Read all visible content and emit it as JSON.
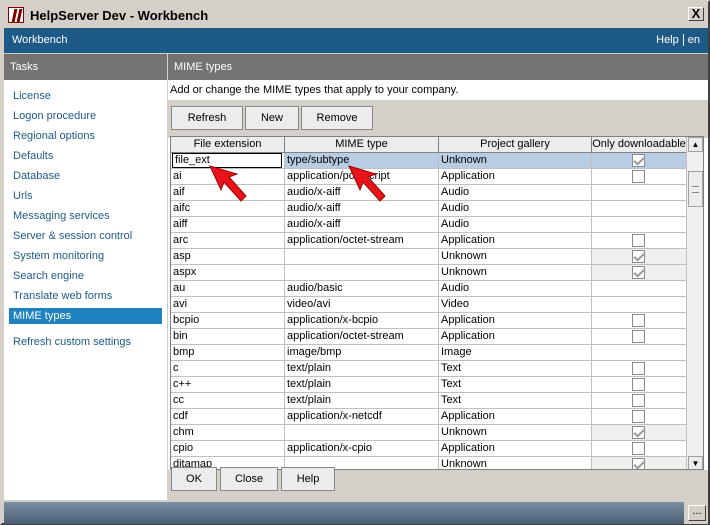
{
  "window": {
    "title": "HelpServer Dev - Workbench",
    "close_symbol": "X"
  },
  "header": {
    "app_name": "Workbench",
    "help_link": "Help",
    "lang_link": "en"
  },
  "sidebar": {
    "title": "Tasks",
    "items": [
      {
        "label": "License"
      },
      {
        "label": "Logon procedure"
      },
      {
        "label": "Regional options"
      },
      {
        "label": "Defaults"
      },
      {
        "label": "Database"
      },
      {
        "label": "Urls"
      },
      {
        "label": "Messaging services"
      },
      {
        "label": "Server & session control"
      },
      {
        "label": "System monitoring"
      },
      {
        "label": "Search engine"
      },
      {
        "label": "Translate web forms"
      },
      {
        "label": "MIME types",
        "active": true
      }
    ],
    "extra_item": "Refresh custom settings"
  },
  "main": {
    "title": "MIME types",
    "description": "Add or change the MIME types that apply to your company.",
    "buttons": {
      "refresh": "Refresh",
      "new": "New",
      "remove": "Remove"
    },
    "columns": [
      "File extension",
      "MIME type",
      "Project gallery",
      "Only downloadable"
    ],
    "rows": [
      {
        "ext": "file_ext",
        "mime": "type/subtype",
        "gallery": "Unknown",
        "dl": "checked"
      },
      {
        "ext": "ai",
        "mime": "application/postscript",
        "gallery": "Application",
        "dl": "unchecked"
      },
      {
        "ext": "aif",
        "mime": "audio/x-aiff",
        "gallery": "Audio",
        "dl": "none"
      },
      {
        "ext": "aifc",
        "mime": "audio/x-aiff",
        "gallery": "Audio",
        "dl": "none"
      },
      {
        "ext": "aiff",
        "mime": "audio/x-aiff",
        "gallery": "Audio",
        "dl": "none"
      },
      {
        "ext": "arc",
        "mime": "application/octet-stream",
        "gallery": "Application",
        "dl": "unchecked"
      },
      {
        "ext": "asp",
        "mime": "",
        "gallery": "Unknown",
        "dl": "checked"
      },
      {
        "ext": "aspx",
        "mime": "",
        "gallery": "Unknown",
        "dl": "checked"
      },
      {
        "ext": "au",
        "mime": "audio/basic",
        "gallery": "Audio",
        "dl": "none"
      },
      {
        "ext": "avi",
        "mime": "video/avi",
        "gallery": "Video",
        "dl": "none"
      },
      {
        "ext": "bcpio",
        "mime": "application/x-bcpio",
        "gallery": "Application",
        "dl": "unchecked"
      },
      {
        "ext": "bin",
        "mime": "application/octet-stream",
        "gallery": "Application",
        "dl": "unchecked"
      },
      {
        "ext": "bmp",
        "mime": "image/bmp",
        "gallery": "Image",
        "dl": "none"
      },
      {
        "ext": "c",
        "mime": "text/plain",
        "gallery": "Text",
        "dl": "unchecked"
      },
      {
        "ext": "c++",
        "mime": "text/plain",
        "gallery": "Text",
        "dl": "unchecked"
      },
      {
        "ext": "cc",
        "mime": "text/plain",
        "gallery": "Text",
        "dl": "unchecked"
      },
      {
        "ext": "cdf",
        "mime": "application/x-netcdf",
        "gallery": "Application",
        "dl": "unchecked"
      },
      {
        "ext": "chm",
        "mime": "",
        "gallery": "Unknown",
        "dl": "checked"
      },
      {
        "ext": "cpio",
        "mime": "application/x-cpio",
        "gallery": "Application",
        "dl": "unchecked"
      },
      {
        "ext": "ditamap",
        "mime": "",
        "gallery": "Unknown",
        "dl": "checked"
      }
    ],
    "footer_buttons": {
      "ok": "OK",
      "close": "Close",
      "help": "Help"
    }
  },
  "status": {
    "corner_button": "..."
  },
  "icons": {
    "app": "helpserver-logo-icon",
    "scroll_up": "scroll-up-arrow-icon",
    "scroll_down": "scroll-down-arrow-icon",
    "annotation": "red-arrow-icon"
  },
  "colors": {
    "header": "#1e5a87",
    "subbar": "#737373",
    "active": "#1e82be",
    "annotation": "#e8141b"
  }
}
